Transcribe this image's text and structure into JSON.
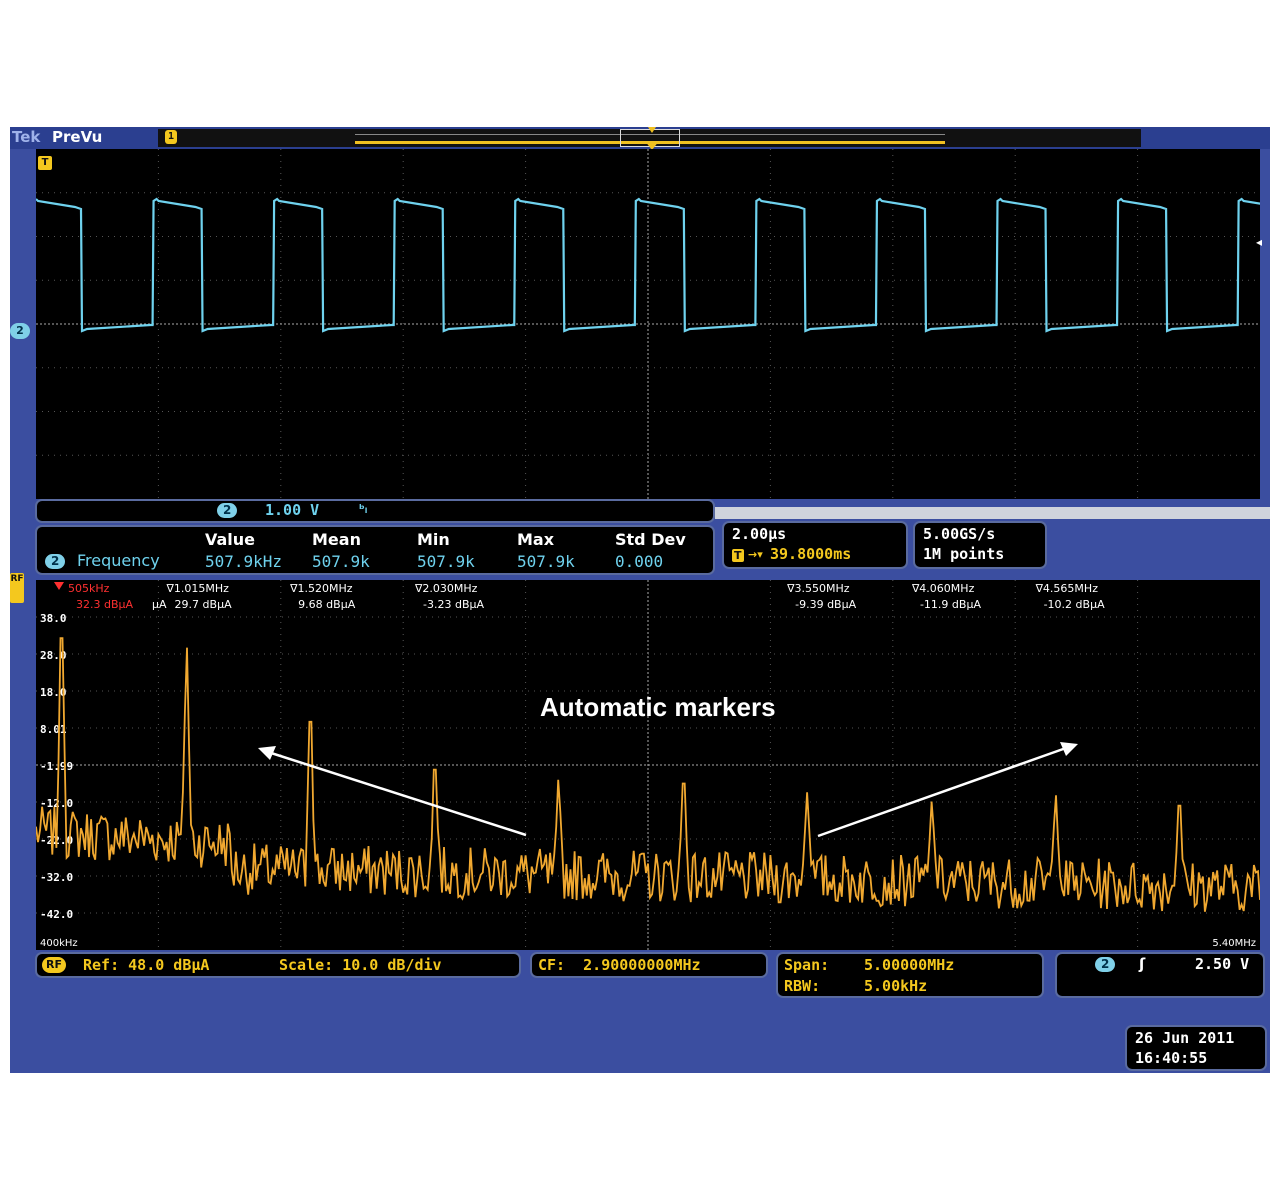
{
  "titlebar": {
    "brand": "Tek",
    "mode": "PreVu",
    "record_marker": "1"
  },
  "waveform": {
    "trigger_marker": "T",
    "channel_marker": "2",
    "channel_color": "#6fd2ee",
    "period_divisions": 0.985
  },
  "channel_readout": {
    "channel": "2",
    "scale": "1.00 V",
    "coupling_icon": "bandwidth-limit-icon"
  },
  "measurements": {
    "headers": [
      "Value",
      "Mean",
      "Min",
      "Max",
      "Std Dev"
    ],
    "channel": "2",
    "name": "Frequency",
    "values": [
      "507.9kHz",
      "507.9k",
      "507.9k",
      "507.9k",
      "0.000"
    ]
  },
  "timebase": {
    "scale": "2.00µs",
    "position": "39.8000ms",
    "trigger_icon": "T"
  },
  "acquisition": {
    "sample_rate": "5.00GS/s",
    "record_length": "1M points"
  },
  "spectrum": {
    "rf_marker": "RF",
    "trace_color": "#f0a830",
    "y_ticks": [
      "38.0",
      "28.0",
      "18.0",
      "8.01",
      "-1.99",
      "-12.0",
      "-22.0",
      "-32.0",
      "-42.0"
    ],
    "x_start": "400kHz",
    "x_end": "5.40MHz",
    "markers": [
      {
        "freq": "505kHz",
        "level": "32.3 dBµA",
        "reference": true
      },
      {
        "freq": "1.015MHz",
        "level": "29.7 dBµA"
      },
      {
        "freq": "1.520MHz",
        "level": "9.68 dBµA"
      },
      {
        "freq": "2.030MHz",
        "level": "-3.23 dBµA"
      },
      {
        "freq": "3.550MHz",
        "level": "-9.39 dBµA"
      },
      {
        "freq": "4.060MHz",
        "level": "-11.9 dBµA"
      },
      {
        "freq": "4.565MHz",
        "level": "-10.2 dBµA"
      }
    ],
    "unit_suffix": "µA",
    "callout": "Automatic markers"
  },
  "rf_settings": {
    "badge": "RF",
    "ref": "Ref: 48.0 dBµA",
    "scale": "Scale: 10.0 dB/div",
    "cf": "CF:  2.90000000MHz",
    "span_label": "Span:",
    "span_value": "5.00000MHz",
    "rbw_label": "RBW:",
    "rbw_value": "5.00kHz"
  },
  "trigger": {
    "channel": "2",
    "slope_icon": "rising-edge-icon",
    "level": "2.50 V"
  },
  "datetime": {
    "date": "26 Jun 2011",
    "time": "16:40:55"
  }
}
